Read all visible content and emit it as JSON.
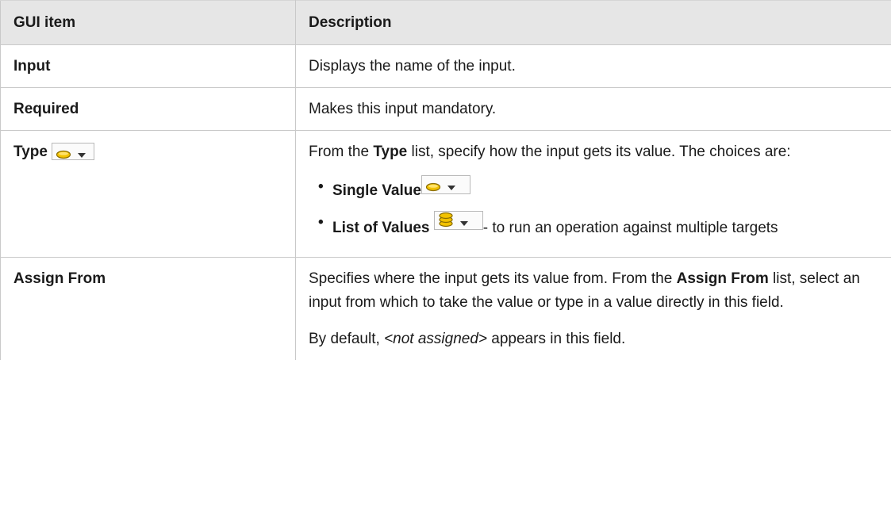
{
  "table": {
    "headers": [
      "GUI item",
      "Description"
    ],
    "rows": [
      {
        "item": "Input",
        "description": "Displays the name of the input."
      },
      {
        "item": "Required",
        "description": "Makes this input mandatory."
      },
      {
        "item": "Type",
        "item_icon": "single-value-coin-icon",
        "description": {
          "intro_pre": "From the ",
          "intro_kw": "Type",
          "intro_post": " list, specify how the input gets its value. The choices are:",
          "choices": [
            {
              "label": "Single Value",
              "icon": "single-value-coin-icon",
              "suffix": ""
            },
            {
              "label": "List of Values",
              "icon": "list-of-values-stack-icon",
              "suffix": "- to run an operation against multiple targets"
            }
          ]
        }
      },
      {
        "item": "Assign From",
        "description": {
          "p1_pre": "Specifies where the input gets its value from. From the ",
          "p1_kw": "Assign From",
          "p1_post": " list, select an input from which to take the value or type in a value directly in this field.",
          "p2_pre": "By default, ",
          "p2_em": "<not assigned>",
          "p2_post": " appears in this field."
        }
      }
    ]
  },
  "colors": {
    "header_bg": "#e6e6e6",
    "border": "#c9c9c9",
    "coin_fill": "#f2c200",
    "coin_stroke": "#8a6d00"
  }
}
